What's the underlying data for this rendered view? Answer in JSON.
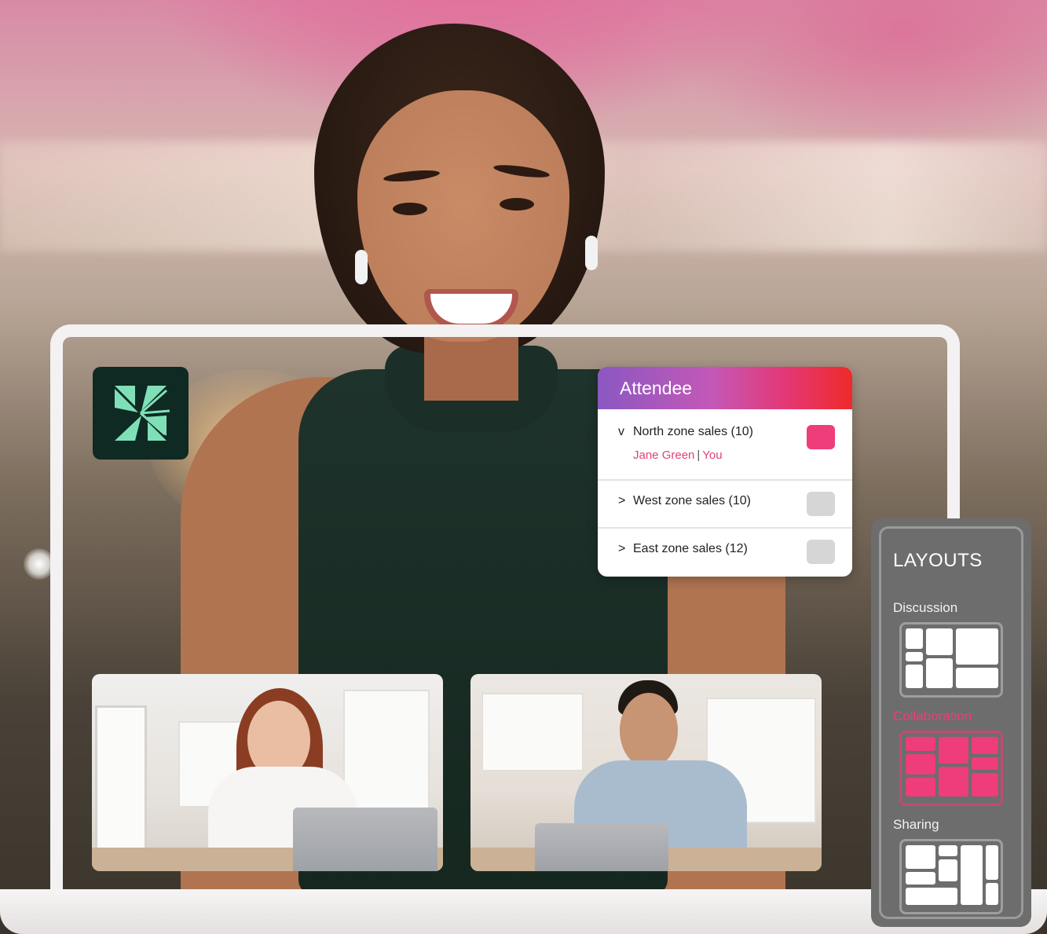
{
  "attendee_panel": {
    "title": "Attendee",
    "groups": [
      {
        "chevron": "v",
        "label": "North zone sales (10)",
        "expanded": true,
        "checked": true,
        "members": [
          {
            "name": "Jane Green",
            "tag": "You"
          }
        ]
      },
      {
        "chevron": ">",
        "label": "West zone sales (10)",
        "expanded": false,
        "checked": false
      },
      {
        "chevron": ">",
        "label": "East zone sales (12)",
        "expanded": false,
        "checked": false
      }
    ]
  },
  "layouts_panel": {
    "title": "LAYOUTS",
    "options": [
      {
        "label": "Discussion",
        "active": false,
        "icon": "discussion-layout-icon"
      },
      {
        "label": "Collaboration",
        "active": true,
        "icon": "collaboration-layout-icon"
      },
      {
        "label": "Sharing",
        "active": false,
        "icon": "sharing-layout-icon"
      }
    ]
  },
  "app_logo": {
    "icon": "adobe-connect-logo-icon"
  },
  "colors": {
    "accent_pink": "#ef3c7a",
    "header_gradient": [
      "#8a58c2",
      "#c458b7",
      "#e53772",
      "#ee2a2a"
    ],
    "logo_bg": "#0f2a22",
    "logo_mark": "#7fe0b8",
    "panel_gray": "#6d6d6d"
  }
}
